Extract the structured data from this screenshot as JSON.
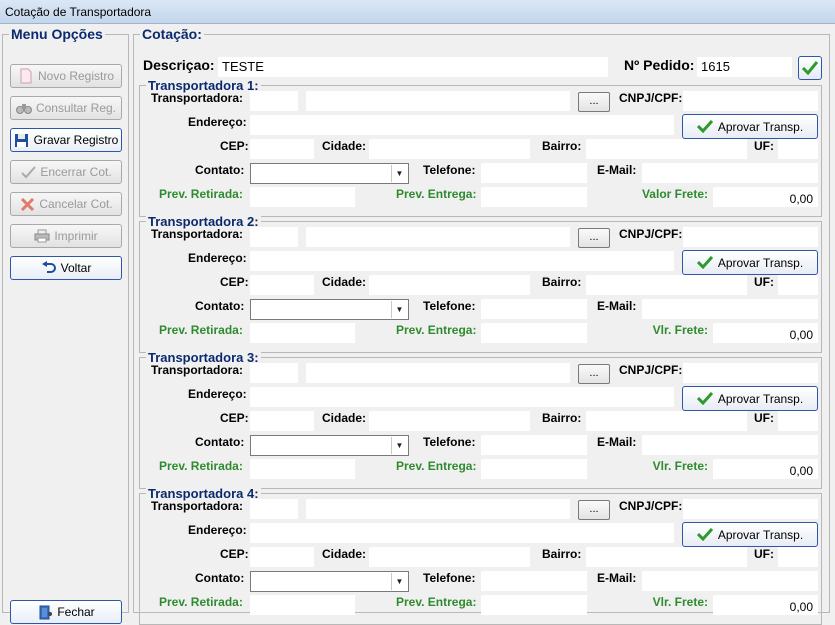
{
  "window": {
    "title": "Cotação de Transportadora"
  },
  "menu": {
    "legend": "Menu Opções",
    "buttons": {
      "novo": "Novo Registro",
      "consultar": "Consultar Reg.",
      "gravar": "Gravar Registro",
      "encerrar": "Encerrar Cot.",
      "cancelar": "Cancelar Cot.",
      "imprimir": "Imprimir",
      "voltar": "Voltar",
      "fechar": "Fechar"
    }
  },
  "cotacao": {
    "legend": "Cotação:",
    "descricao_label": "Descriçao:",
    "descricao_value": "TESTE",
    "pedido_label": "Nº Pedido:",
    "pedido_value": "1615"
  },
  "labels": {
    "transportadora": "Transportadora:",
    "cnpj": "CNPJ/CPF:",
    "endereco": "Endereço:",
    "aprovar": "Aprovar Transp.",
    "cep": "CEP:",
    "cidade": "Cidade:",
    "bairro": "Bairro:",
    "uf": "UF:",
    "contato": "Contato:",
    "telefone": "Telefone:",
    "email": "E-Mail:",
    "prev_retirada": "Prev. Retirada:",
    "prev_entrega": "Prev. Entrega:",
    "dots": "..."
  },
  "sections": [
    {
      "title": "Transportadora 1:",
      "frete_label": "Valor Frete:",
      "frete_value": "0,00"
    },
    {
      "title": "Transportadora 2:",
      "frete_label": "Vlr. Frete:",
      "frete_value": "0,00"
    },
    {
      "title": "Transportadora 3:",
      "frete_label": "Vlr. Frete:",
      "frete_value": "0,00"
    },
    {
      "title": "Transportadora 4:",
      "frete_label": "Vlr. Frete:",
      "frete_value": "0,00"
    }
  ]
}
